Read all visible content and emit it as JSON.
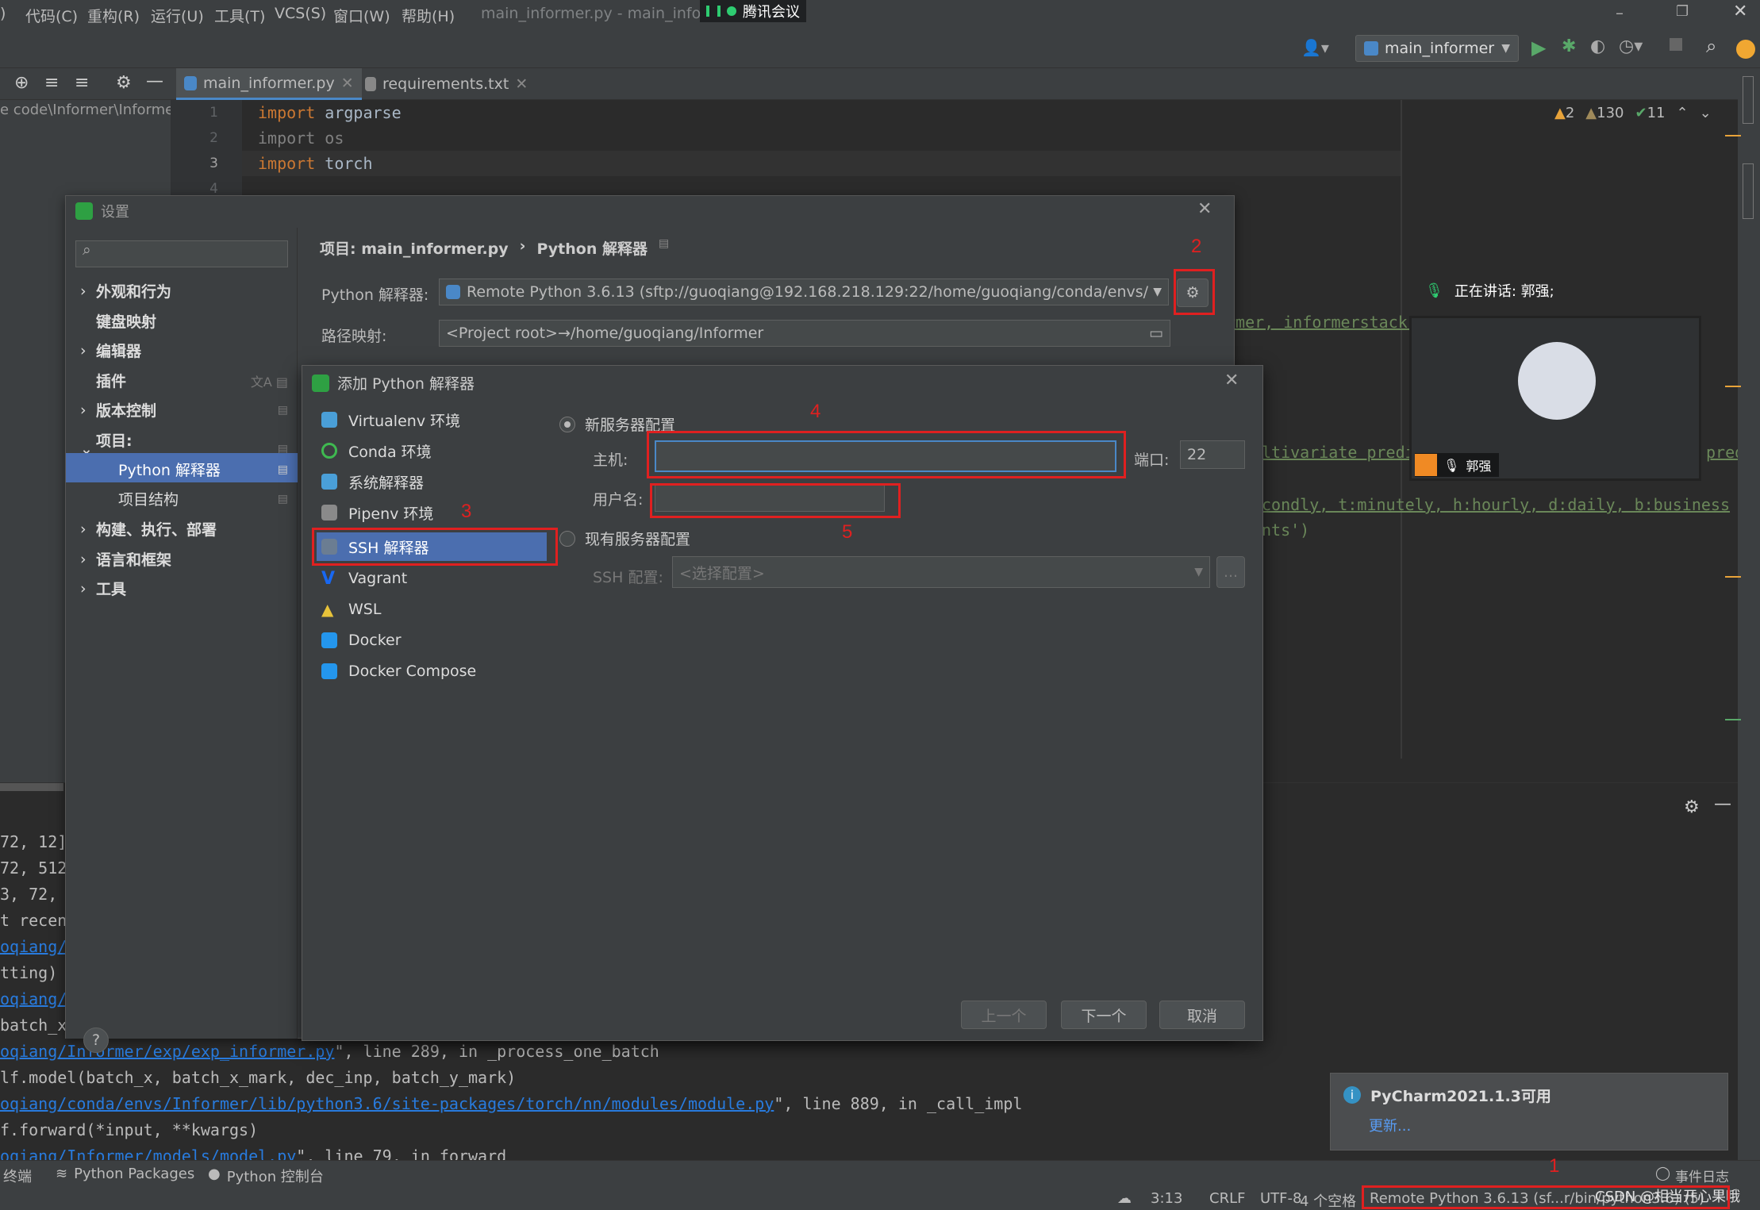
{
  "menu": {
    "items": [
      ")",
      "代码(C)",
      "重构(R)",
      "运行(U)",
      "工具(T)",
      "VCS(S)",
      "窗口(W)",
      "帮助(H)"
    ],
    "title": "main_informer.py - main_inform",
    "meeting_app": "腾讯会议"
  },
  "toolbar": {
    "run_config": "main_informer"
  },
  "tabs": [
    {
      "label": "main_informer.py"
    },
    {
      "label": "requirements.txt"
    }
  ],
  "project": {
    "path": "e code\\Informer\\Informe"
  },
  "editor": {
    "lines": [
      {
        "no": "1",
        "kw": "import",
        "rest": " argparse"
      },
      {
        "no": "2",
        "kw": "import",
        "rest": " os"
      },
      {
        "no": "3",
        "kw": "import",
        "rest": " torch"
      },
      {
        "no": "4",
        "kw": "",
        "rest": ""
      }
    ],
    "inspection": {
      "warnings": "2",
      "weak": "130",
      "typos": "11"
    },
    "frag1": "rmer, informerstack,",
    "frag2": "ltivariate predi",
    "frag3": "predi",
    "frag4": "condly, t:minutely, h:hourly, d:daily, b:business",
    "frag5": "nts')"
  },
  "run": {
    "lines_left": [
      "72, 12]",
      "72, 512",
      "3, 72, ",
      "t recent",
      "oqiang/",
      "tting)",
      "oqiang/",
      "batch_x"
    ],
    "l1_link": "oqiang/Informer/exp/exp_informer.py",
    "l1_rest": "\", line 289, in _process_one_batch",
    "l2": "lf.model(batch_x, batch_x_mark, dec_inp, batch_y_mark)",
    "l3_link": "oqiang/conda/envs/Informer/lib/python3.6/site-packages/torch/nn/modules/module.py",
    "l3_rest": "\", line 889, in _call_impl",
    "l4": "f.forward(*input, **kwargs)",
    "l5_link": "oqiang/Informer/models/model.py",
    "l5_rest": "\", line 79, in forward"
  },
  "settings": {
    "title": "设置",
    "breadcrumb_project": "项目: main_informer.py",
    "breadcrumb_sep": "›",
    "breadcrumb_page": "Python 解释器",
    "interpreter_label": "Python 解释器:",
    "interpreter_value": "Remote Python 3.6.13 (sftp://guoqiang@192.168.218.129:22/home/guoqiang/conda/envs/Informer",
    "path_label": "路径映射:",
    "path_value": "<Project root>→/home/guoqiang/Informer",
    "nav": [
      {
        "label": "外观和行为",
        "arrow": "›"
      },
      {
        "label": "键盘映射",
        "arrow": ""
      },
      {
        "label": "编辑器",
        "arrow": "›"
      },
      {
        "label": "插件",
        "arrow": ""
      },
      {
        "label": "版本控制",
        "arrow": "›"
      },
      {
        "label": "项目: main_informer.py",
        "arrow": "⌄"
      },
      {
        "label": "Python 解释器",
        "arrow": ""
      },
      {
        "label": "项目结构",
        "arrow": ""
      },
      {
        "label": "构建、执行、部署",
        "arrow": "›"
      },
      {
        "label": "语言和框架",
        "arrow": "›"
      },
      {
        "label": "工具",
        "arrow": "›"
      }
    ],
    "help": "?"
  },
  "dialog": {
    "title": "添加 Python 解释器",
    "items": [
      {
        "label": "Virtualenv 环境",
        "color": "#4a9fd8"
      },
      {
        "label": "Conda 环境",
        "color": "#3fb950"
      },
      {
        "label": "系统解释器",
        "color": "#4a9fd8"
      },
      {
        "label": "Pipenv 环境",
        "color": "#8a8a8a"
      },
      {
        "label": "SSH 解释器",
        "color": "#6b7d92"
      },
      {
        "label": "Vagrant",
        "color": "#1868f2"
      },
      {
        "label": "WSL",
        "color": "#e8c33a"
      },
      {
        "label": "Docker",
        "color": "#2496ed"
      },
      {
        "label": "Docker Compose",
        "color": "#2496ed"
      }
    ],
    "radio_new": "新服务器配置",
    "host_label": "主机:",
    "host_value": "",
    "port_label": "端口:",
    "port_value": "22",
    "user_label": "用户名:",
    "user_value": "",
    "radio_existing": "现有服务器配置",
    "ssh_label": "SSH 配置:",
    "ssh_value": "<选择配置>",
    "browse": "...",
    "btn_prev": "上一个",
    "btn_next": "下一个",
    "btn_cancel": "取消"
  },
  "annotations": [
    "1",
    "2",
    "3",
    "4",
    "5"
  ],
  "meeting": {
    "speaking": "正在讲话: 郭强;",
    "name": "郭强"
  },
  "notification": {
    "title": "PyCharm2021.1.3可用",
    "link": "更新..."
  },
  "bottom_tools": {
    "terminal": "终端",
    "packages": "Python Packages",
    "console": "Python 控制台",
    "event_log": "事件日志"
  },
  "status": {
    "pos": "3:13",
    "eol": "CRLF",
    "enc": "UTF-8",
    "indent": "4 个空格",
    "interpreter": "Remote Python 3.6.13 (sf...r/bin/python3.6) (5)",
    "watermark": "CSDN @相当开心果哦"
  },
  "colors": {
    "accent": "#4a88c7",
    "selection": "#4b6eaf",
    "annotation": "#e02020"
  }
}
